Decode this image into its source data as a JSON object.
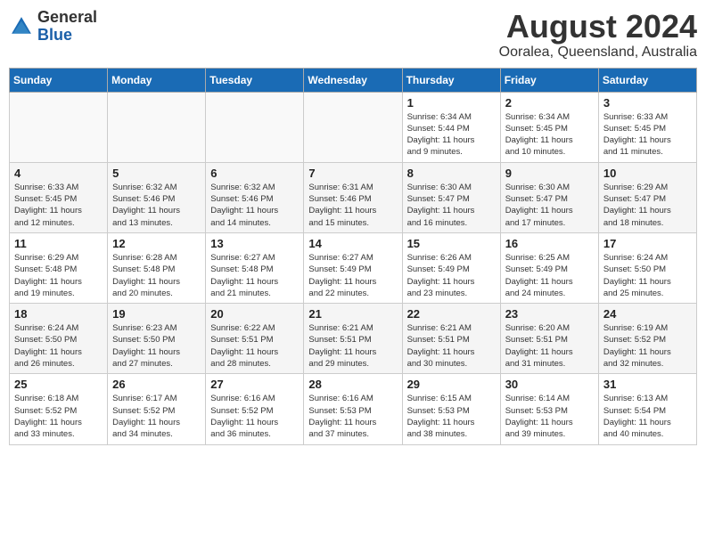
{
  "header": {
    "logo_general": "General",
    "logo_blue": "Blue",
    "title": "August 2024",
    "subtitle": "Ooralea, Queensland, Australia"
  },
  "calendar": {
    "days_of_week": [
      "Sunday",
      "Monday",
      "Tuesday",
      "Wednesday",
      "Thursday",
      "Friday",
      "Saturday"
    ],
    "weeks": [
      [
        {
          "day": "",
          "info": "",
          "empty": true
        },
        {
          "day": "",
          "info": "",
          "empty": true
        },
        {
          "day": "",
          "info": "",
          "empty": true
        },
        {
          "day": "",
          "info": "",
          "empty": true
        },
        {
          "day": "1",
          "info": "Sunrise: 6:34 AM\nSunset: 5:44 PM\nDaylight: 11 hours\nand 9 minutes."
        },
        {
          "day": "2",
          "info": "Sunrise: 6:34 AM\nSunset: 5:45 PM\nDaylight: 11 hours\nand 10 minutes."
        },
        {
          "day": "3",
          "info": "Sunrise: 6:33 AM\nSunset: 5:45 PM\nDaylight: 11 hours\nand 11 minutes."
        }
      ],
      [
        {
          "day": "4",
          "info": "Sunrise: 6:33 AM\nSunset: 5:45 PM\nDaylight: 11 hours\nand 12 minutes."
        },
        {
          "day": "5",
          "info": "Sunrise: 6:32 AM\nSunset: 5:46 PM\nDaylight: 11 hours\nand 13 minutes."
        },
        {
          "day": "6",
          "info": "Sunrise: 6:32 AM\nSunset: 5:46 PM\nDaylight: 11 hours\nand 14 minutes."
        },
        {
          "day": "7",
          "info": "Sunrise: 6:31 AM\nSunset: 5:46 PM\nDaylight: 11 hours\nand 15 minutes."
        },
        {
          "day": "8",
          "info": "Sunrise: 6:30 AM\nSunset: 5:47 PM\nDaylight: 11 hours\nand 16 minutes."
        },
        {
          "day": "9",
          "info": "Sunrise: 6:30 AM\nSunset: 5:47 PM\nDaylight: 11 hours\nand 17 minutes."
        },
        {
          "day": "10",
          "info": "Sunrise: 6:29 AM\nSunset: 5:47 PM\nDaylight: 11 hours\nand 18 minutes."
        }
      ],
      [
        {
          "day": "11",
          "info": "Sunrise: 6:29 AM\nSunset: 5:48 PM\nDaylight: 11 hours\nand 19 minutes."
        },
        {
          "day": "12",
          "info": "Sunrise: 6:28 AM\nSunset: 5:48 PM\nDaylight: 11 hours\nand 20 minutes."
        },
        {
          "day": "13",
          "info": "Sunrise: 6:27 AM\nSunset: 5:48 PM\nDaylight: 11 hours\nand 21 minutes."
        },
        {
          "day": "14",
          "info": "Sunrise: 6:27 AM\nSunset: 5:49 PM\nDaylight: 11 hours\nand 22 minutes."
        },
        {
          "day": "15",
          "info": "Sunrise: 6:26 AM\nSunset: 5:49 PM\nDaylight: 11 hours\nand 23 minutes."
        },
        {
          "day": "16",
          "info": "Sunrise: 6:25 AM\nSunset: 5:49 PM\nDaylight: 11 hours\nand 24 minutes."
        },
        {
          "day": "17",
          "info": "Sunrise: 6:24 AM\nSunset: 5:50 PM\nDaylight: 11 hours\nand 25 minutes."
        }
      ],
      [
        {
          "day": "18",
          "info": "Sunrise: 6:24 AM\nSunset: 5:50 PM\nDaylight: 11 hours\nand 26 minutes."
        },
        {
          "day": "19",
          "info": "Sunrise: 6:23 AM\nSunset: 5:50 PM\nDaylight: 11 hours\nand 27 minutes."
        },
        {
          "day": "20",
          "info": "Sunrise: 6:22 AM\nSunset: 5:51 PM\nDaylight: 11 hours\nand 28 minutes."
        },
        {
          "day": "21",
          "info": "Sunrise: 6:21 AM\nSunset: 5:51 PM\nDaylight: 11 hours\nand 29 minutes."
        },
        {
          "day": "22",
          "info": "Sunrise: 6:21 AM\nSunset: 5:51 PM\nDaylight: 11 hours\nand 30 minutes."
        },
        {
          "day": "23",
          "info": "Sunrise: 6:20 AM\nSunset: 5:51 PM\nDaylight: 11 hours\nand 31 minutes."
        },
        {
          "day": "24",
          "info": "Sunrise: 6:19 AM\nSunset: 5:52 PM\nDaylight: 11 hours\nand 32 minutes."
        }
      ],
      [
        {
          "day": "25",
          "info": "Sunrise: 6:18 AM\nSunset: 5:52 PM\nDaylight: 11 hours\nand 33 minutes."
        },
        {
          "day": "26",
          "info": "Sunrise: 6:17 AM\nSunset: 5:52 PM\nDaylight: 11 hours\nand 34 minutes."
        },
        {
          "day": "27",
          "info": "Sunrise: 6:16 AM\nSunset: 5:52 PM\nDaylight: 11 hours\nand 36 minutes."
        },
        {
          "day": "28",
          "info": "Sunrise: 6:16 AM\nSunset: 5:53 PM\nDaylight: 11 hours\nand 37 minutes."
        },
        {
          "day": "29",
          "info": "Sunrise: 6:15 AM\nSunset: 5:53 PM\nDaylight: 11 hours\nand 38 minutes."
        },
        {
          "day": "30",
          "info": "Sunrise: 6:14 AM\nSunset: 5:53 PM\nDaylight: 11 hours\nand 39 minutes."
        },
        {
          "day": "31",
          "info": "Sunrise: 6:13 AM\nSunset: 5:54 PM\nDaylight: 11 hours\nand 40 minutes."
        }
      ]
    ]
  }
}
